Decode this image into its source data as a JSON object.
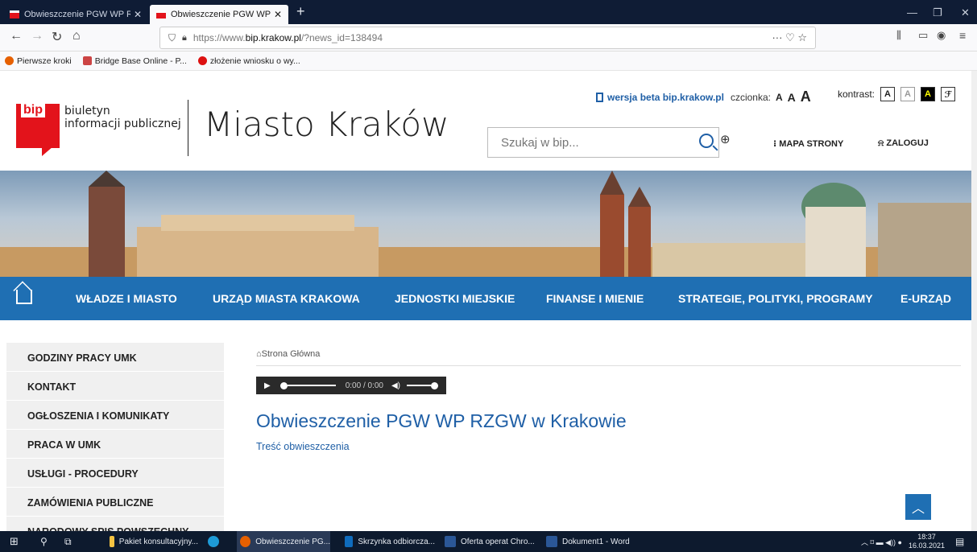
{
  "browser": {
    "tabs": [
      {
        "title": "Obwieszczenie PGW WP RZGW"
      },
      {
        "title": "Obwieszczenie PGW WP RZGW"
      }
    ],
    "url_prefix": "https://www.",
    "url_domain": "bip.krakow.pl",
    "url_suffix": "/?news_id=138494",
    "bookmarks": [
      {
        "label": "Pierwsze kroki"
      },
      {
        "label": "Bridge Base Online - P..."
      },
      {
        "label": "złożenie wniosku o wy..."
      }
    ]
  },
  "header": {
    "logo_mark": "bip",
    "logo_line1": "biuletyn",
    "logo_line2": "informacji publicznej",
    "site_title": "Miasto Kraków",
    "beta_link": "wersja beta bip.krakow.pl",
    "font_label": "czcionka:",
    "font_sizes": [
      "A",
      "A",
      "A"
    ],
    "contrast_label": "kontrast:",
    "contrast_buttons": [
      "A",
      "A",
      "A"
    ],
    "search_placeholder": "Szukaj w bip...",
    "mapa": "MAPA STRONY",
    "zaloguj": "ZALOGUJ"
  },
  "menu": {
    "items": [
      "WŁADZE I MIASTO",
      "URZĄD MIASTA KRAKOWA",
      "JEDNOSTKI MIEJSKIE",
      "FINANSE I MIENIE",
      "STRATEGIE, POLITYKI, PROGRAMY",
      "E-URZĄD"
    ]
  },
  "sidebar": {
    "items": [
      "GODZINY PRACY UMK",
      "KONTAKT",
      "OGŁOSZENIA I KOMUNIKATY",
      "PRACA W UMK",
      "USŁUGI - PROCEDURY",
      "ZAMÓWIENIA PUBLICZNE",
      "NARODOWY SPIS POWSZECHNY"
    ]
  },
  "content": {
    "breadcrumb": "Strona Główna",
    "player_time": "0:00",
    "player_duration": "0:00",
    "title": "Obwieszczenie PGW WP RZGW w Krakowie",
    "link": "Treść obwieszczenia"
  },
  "taskbar": {
    "apps": [
      "Pakiet konsultacyjny...",
      "Obwieszczenie PG...",
      "Skrzynka odbiorcza...",
      "Oferta operat Chro...",
      "Dokument1 - Word"
    ],
    "time": "18:37",
    "date": "16.03.2021"
  },
  "colors": {
    "accent": "#1f6fb3",
    "brand_red": "#e3131b",
    "link": "#1f5fa6"
  }
}
